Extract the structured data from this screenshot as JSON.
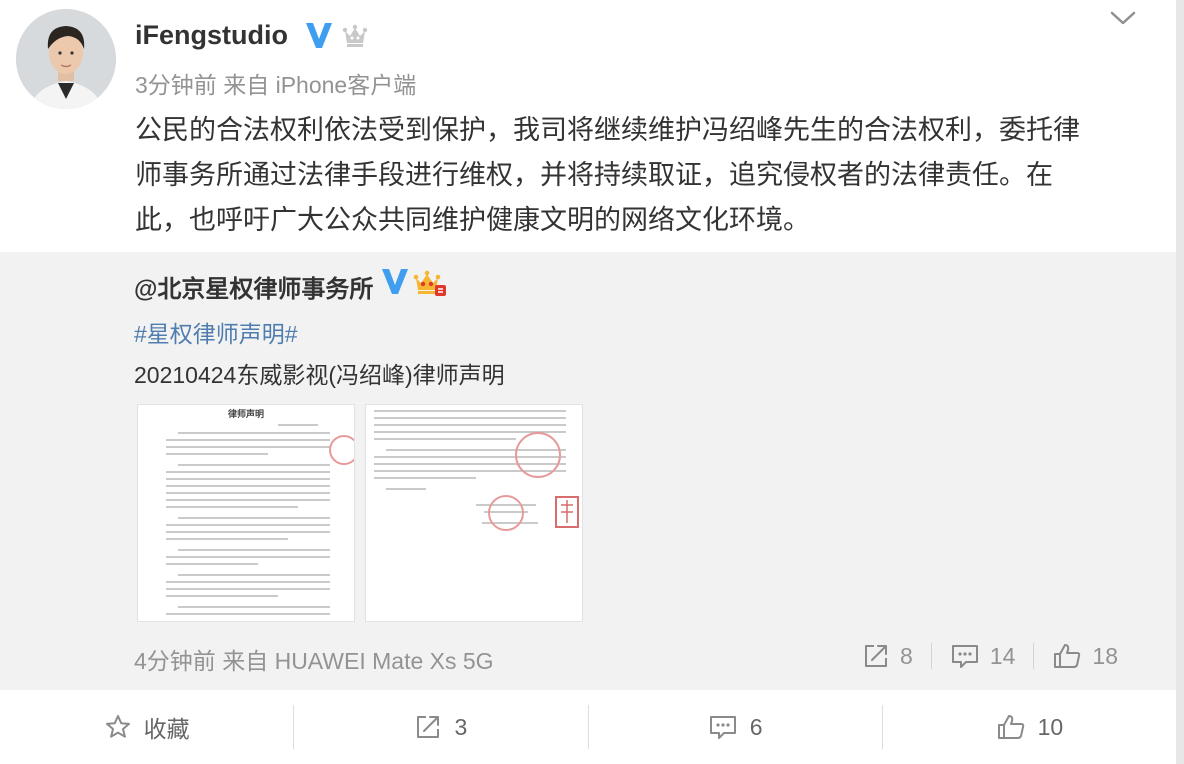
{
  "post": {
    "username": "iFengstudio",
    "time": "3分钟前",
    "from_prefix": "来自",
    "source": "iPhone客户端",
    "content_lines": [
      "公民的合法权利依法受到保护，我司将继续维护冯绍峰先生的合法权利，委托律",
      "师事务所通过法律手段进行维权，并将持续取证，追究侵权者的法律责任。在",
      "此，也呼吁广大公众共同维护健康文明的网络文化环境。"
    ]
  },
  "repost": {
    "author": "@北京星权律师事务所",
    "hashtag": "#星权律师声明#",
    "text": "20210424东威影视(冯绍峰)律师声明",
    "doc_title": "律师声明",
    "time": "4分钟前",
    "from_prefix": "来自",
    "source": "HUAWEI Mate Xs 5G",
    "shares": "8",
    "comments": "14",
    "likes": "18"
  },
  "bottom_bar": {
    "favorite_label": "收藏",
    "shares": "3",
    "comments": "6",
    "likes": "10"
  },
  "colors": {
    "verified": "#3f9ef0",
    "link": "#507daf",
    "meta": "#939393",
    "repost_bg": "#f2f2f2"
  },
  "icons": [
    "verified-v-icon",
    "member-crown-icon",
    "chevron-down-icon",
    "share-icon",
    "comment-icon",
    "like-icon",
    "star-icon"
  ]
}
